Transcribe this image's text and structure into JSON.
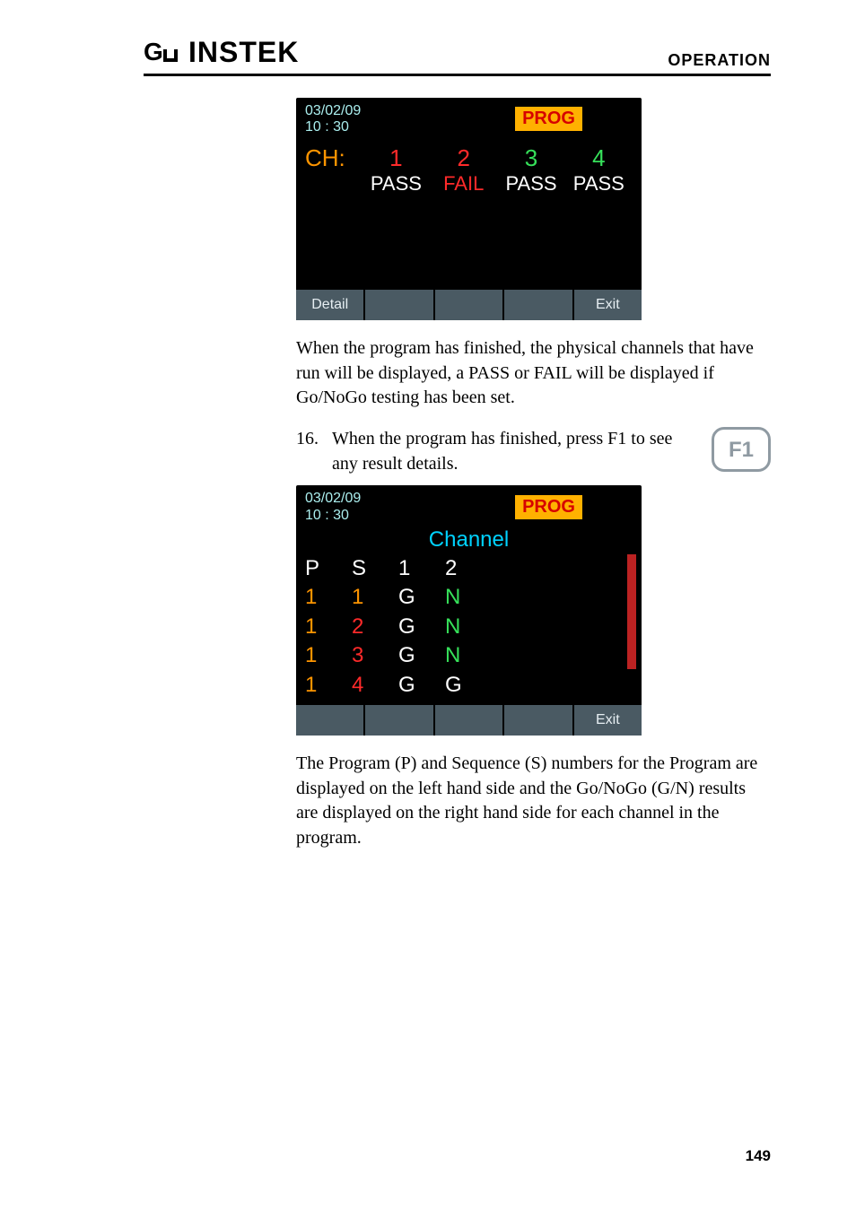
{
  "header": {
    "brand_text": "INSTEK",
    "section": "OPERATION"
  },
  "screen1": {
    "date": "03/02/09",
    "time": "10 : 30",
    "mode_badge": "PROG",
    "ch_label": "CH:",
    "cols": [
      {
        "num": "1",
        "num_color": "red",
        "result": "PASS",
        "pass": true
      },
      {
        "num": "2",
        "num_color": "red",
        "result": "FAIL",
        "pass": false
      },
      {
        "num": "3",
        "num_color": "green",
        "result": "PASS",
        "pass": true
      },
      {
        "num": "4",
        "num_color": "green",
        "result": "PASS",
        "pass": true
      }
    ],
    "footer": {
      "f1": "Detail",
      "f2": "",
      "f3": "",
      "f4": "",
      "f5": "Exit"
    }
  },
  "paragraph1": "When the program has finished, the physical channels that have run will be displayed, a PASS or FAIL will be displayed if Go/NoGo testing has been set.",
  "step16": {
    "num": "16.",
    "text": "When the program has finished, press F1 to see any result details.",
    "key_label": "F1"
  },
  "screen2": {
    "date": "03/02/09",
    "time": "10 : 30",
    "mode_badge": "PROG",
    "title": "Channel",
    "header_row": [
      "P",
      "S",
      "1",
      "2"
    ],
    "rows": [
      {
        "p": "1",
        "s": "1",
        "c1": "G",
        "c2": "N"
      },
      {
        "p": "1",
        "s": "2",
        "c1": "G",
        "c2": "N"
      },
      {
        "p": "1",
        "s": "3",
        "c1": "G",
        "c2": "N"
      },
      {
        "p": "1",
        "s": "4",
        "c1": "G",
        "c2": "G"
      }
    ],
    "footer": {
      "f1": "",
      "f2": "",
      "f3": "",
      "f4": "",
      "f5": "Exit"
    }
  },
  "paragraph2": "The Program (P) and Sequence (S) numbers for the Program are displayed on the left hand side and the Go/NoGo (G/N) results are displayed on the right hand side for each channel in the program.",
  "page_number": "149"
}
